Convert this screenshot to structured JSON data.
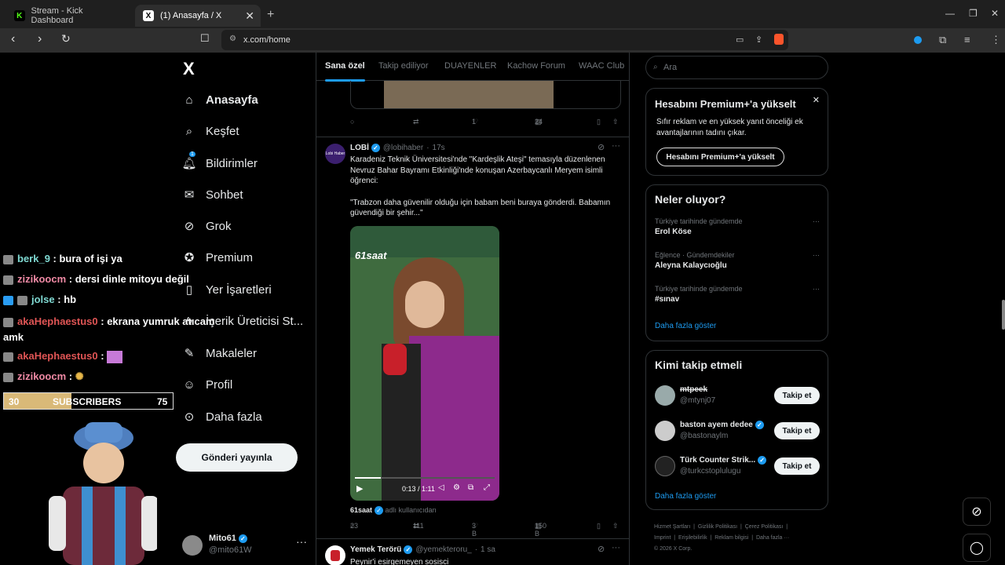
{
  "browser": {
    "tabs": [
      {
        "title": "Stream - Kick Dashboard",
        "favicon": "K",
        "color": "#53fc18"
      },
      {
        "title": "(1) Anasayfa / X",
        "favicon": "X",
        "color": "#000000"
      }
    ],
    "url": "x.com/home"
  },
  "sidebar": {
    "logo": "X",
    "items": [
      {
        "label": "Anasayfa",
        "icon": "home-icon"
      },
      {
        "label": "Keşfet",
        "icon": "search-icon"
      },
      {
        "label": "Bildirimler",
        "icon": "bell-icon",
        "badge": "1"
      },
      {
        "label": "Sohbet",
        "icon": "mail-icon"
      },
      {
        "label": "Grok",
        "icon": "grok-icon"
      },
      {
        "label": "Premium",
        "icon": "verified-icon"
      },
      {
        "label": "Yer İşaretleri",
        "icon": "bookmark-icon"
      },
      {
        "label": "İçerik Üreticisi St...",
        "icon": "bolt-icon"
      },
      {
        "label": "Makaleler",
        "icon": "article-icon"
      },
      {
        "label": "Profil",
        "icon": "person-icon"
      },
      {
        "label": "Daha fazla",
        "icon": "more-circle-icon"
      }
    ],
    "post_button": "Gönderi yayınla",
    "user": {
      "name": "Mito61",
      "handle": "@mito61W"
    }
  },
  "feed": {
    "tabs": [
      "Sana özel",
      "Takip ediliyor",
      "DUAYENLER",
      "Kachow Forum",
      "WAAC Club"
    ],
    "prev_tweet_actions": {
      "replies": "",
      "retweets": "",
      "likes": "1",
      "views": "24"
    },
    "tweet": {
      "author": "LOBİ",
      "avatar_text": "Lobi Haber",
      "handle": "@lobihaber",
      "time": "17s",
      "text1": "Karadeniz Teknik Üniversitesi'nde \"Kardeşlik Ateşi\" temasıyla düzenlenen Nevruz Bahar Bayramı Etkinliği'nde konuşan Azerbaycanlı Meryem isimli öğrenci:",
      "text2": "\"Trabzon daha güvenilir olduğu için babam beni buraya gönderdi. Babamın güvendiği bir şehir...\"",
      "video_logo": "61saat",
      "video_time": "0:13 / 1:11",
      "source_name": "61saat",
      "source_suffix": "adlı kullanıcıdan",
      "replies": "23",
      "retweets": "111",
      "likes": "3 B",
      "views": "150 B"
    },
    "next_tweet": {
      "author": "Yemek Terörü",
      "handle": "@yemekteroru_",
      "time": "1 sa",
      "text": "Peynir'i esirgemeyen sosisci"
    }
  },
  "right": {
    "search_placeholder": "Ara",
    "premium": {
      "title": "Hesabını Premium+'a yükselt",
      "body": "Sıfır reklam ve en yüksek yanıt önceliği ek avantajlarının tadını çıkar.",
      "button": "Hesabını Premium+'a yükselt"
    },
    "trends": {
      "title": "Neler oluyor?",
      "items": [
        {
          "context": "Türkiye tarihinde gündemde",
          "name": "Erol Köse"
        },
        {
          "context": "Eğlence · Gündemdekiler",
          "name": "Aleyna Kalaycıoğlu"
        },
        {
          "context": "Türkiye tarihinde gündemde",
          "name": "#sınav"
        }
      ],
      "more": "Daha fazla göster"
    },
    "follow": {
      "title": "Kimi takip etmeli",
      "items": [
        {
          "name": "mtpeek",
          "handle": "@mtynj07",
          "verified": false
        },
        {
          "name": "baston ayem dedee",
          "handle": "@bastonaylm",
          "verified": true
        },
        {
          "name": "Türk Counter Strik...",
          "handle": "@turkcstoplulugu",
          "verified": true
        }
      ],
      "button": "Takip et",
      "more": "Daha fazla göster"
    },
    "footer": [
      "Hizmet Şartları",
      "Gizlilik Politikası",
      "Çerez Politikası",
      "Imprint",
      "Erişilebilirlik",
      "Reklam bilgisi",
      "Daha fazla ···",
      "© 2026 X Corp."
    ]
  },
  "stream": {
    "chat": [
      {
        "user": "berk_9",
        "msg": ": bura of işi ya",
        "color": "#7fd9d2"
      },
      {
        "user": "zizikoocm",
        "msg": ": dersi dinle mitoyu değil",
        "color": "#f08aa5"
      },
      {
        "user": "jolse",
        "msg": ": hb",
        "color": "#7fd9d2"
      },
      {
        "user": "akaHephaestus0",
        "msg": ": ekrana yumruk atıcam amk",
        "color": "#e05555"
      },
      {
        "user": "akaHephaestus0",
        "msg": ":",
        "color": "#e05555"
      },
      {
        "user": "zizikoocm",
        "msg": ":",
        "color": "#f08aa5"
      }
    ],
    "sub_bar": {
      "left": "30",
      "label": "SUBSCRIBERS",
      "right": "75",
      "fill": 0.4
    }
  }
}
